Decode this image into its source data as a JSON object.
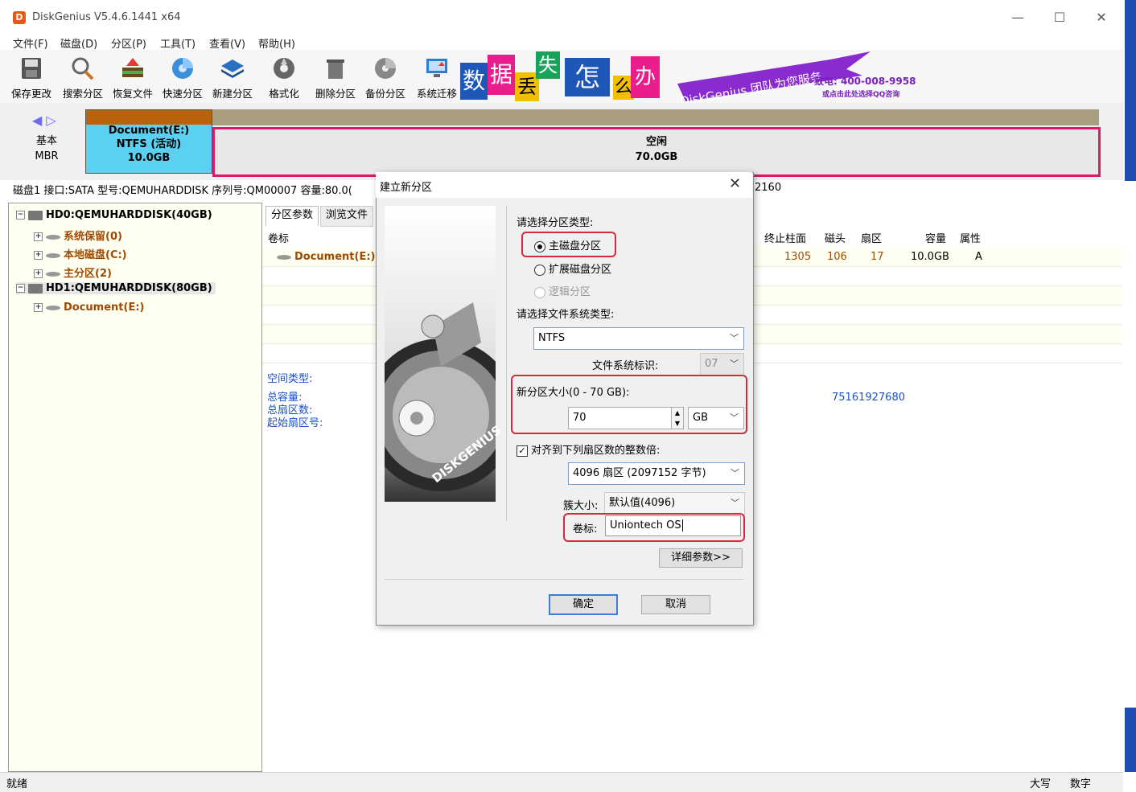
{
  "window": {
    "title": "DiskGenius V5.4.6.1441 x64",
    "minimize": "—",
    "maximize": "☐",
    "close": "✕"
  },
  "menu": [
    "文件(F)",
    "磁盘(D)",
    "分区(P)",
    "工具(T)",
    "查看(V)",
    "帮助(H)"
  ],
  "toolbar": [
    "保存更改",
    "搜索分区",
    "恢复文件",
    "快速分区",
    "新建分区",
    "格式化",
    "删除分区",
    "备份分区",
    "系统迁移"
  ],
  "banner": {
    "chars": [
      "数",
      "据",
      "丢",
      "失",
      "怎",
      "么",
      "办"
    ],
    "brand": "DiskGenius 团队为您服务",
    "phone": "致电: 400-008-9958",
    "qq": "或点击此处选择QQ咨询"
  },
  "diskbar": {
    "basic": "基本",
    "mbr": "MBR",
    "part_name": "Document(E:)",
    "part_fs": "NTFS (活动)",
    "part_size": "10.0GB",
    "free_label": "空闲",
    "free_size": "70.0GB"
  },
  "disk_info": "磁盘1 接口:SATA  型号:QEMUHARDDISK  序列号:QM00007  容量:80.0(",
  "disk_info_tail": "2160",
  "tree": {
    "hd0": "HD0:QEMUHARDDISK(40GB)",
    "hd0_items": [
      "系统保留(0)",
      "本地磁盘(C:)",
      "主分区(2)"
    ],
    "hd1": "HD1:QEMUHARDDISK(80GB)",
    "hd1_items": [
      "Document(E:)"
    ]
  },
  "tabs": [
    "分区参数",
    "浏览文件"
  ],
  "table": {
    "col_volume": "卷标",
    "headers": [
      "终止柱面",
      "磁头",
      "扇区",
      "容量",
      "属性"
    ],
    "row_volume": "Document(E:)",
    "row": [
      "1305",
      "106",
      "17",
      "10.0GB",
      "A"
    ]
  },
  "details": {
    "space_type": "空间类型:",
    "total_capacity": "总容量:",
    "total_sectors": "总扇区数:",
    "start_sector": "起始扇区号:",
    "bytes_value": "75161927680"
  },
  "status": {
    "ready": "就绪",
    "caps": "大写",
    "num": "数字"
  },
  "dialog": {
    "title": "建立新分区",
    "close": "✕",
    "type_label": "请选择分区类型:",
    "radio_primary": "主磁盘分区",
    "radio_extended": "扩展磁盘分区",
    "radio_logical": "逻辑分区",
    "fs_label": "请选择文件系统类型:",
    "fs_value": "NTFS",
    "fs_id_label": "文件系统标识:",
    "fs_id_value": "07",
    "size_label": "新分区大小(0 - 70 GB):",
    "size_value": "70",
    "size_unit": "GB",
    "align_label": "对齐到下列扇区数的整数倍:",
    "align_value": "4096 扇区 (2097152 字节)",
    "cluster_label": "簇大小:",
    "cluster_value": "默认值(4096)",
    "volume_label": "卷标:",
    "volume_value": "Uniontech OS",
    "details_button": "详细参数>>",
    "ok": "确定",
    "cancel": "取消",
    "image_brand": "DISKGENIUS"
  }
}
